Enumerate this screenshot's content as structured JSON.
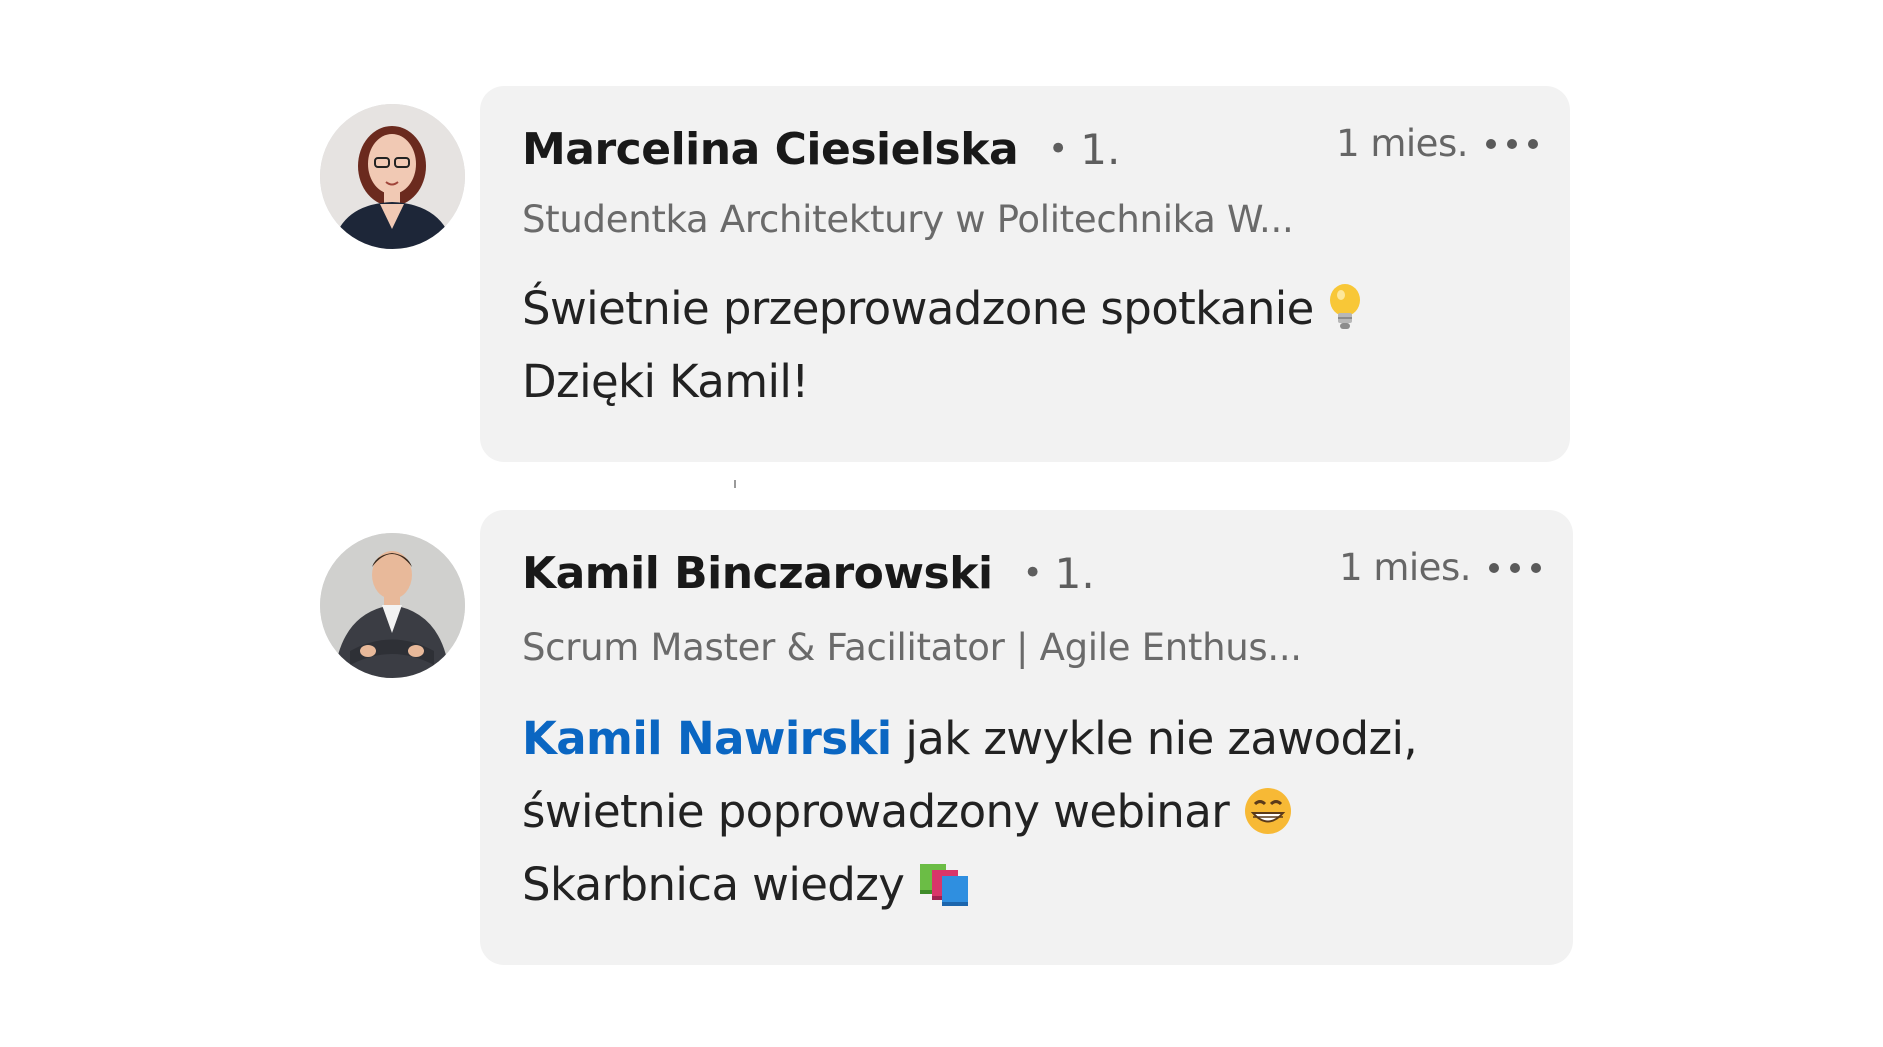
{
  "comments": [
    {
      "author": "Marcelina Ciesielska",
      "degree": "1.",
      "time": "1 mies.",
      "headline": "Studentka Architektury w Politechnika W...",
      "lines": [
        "Świetnie przeprowadzone spotkanie",
        "Dzięki Kamil!"
      ],
      "emoji": "light-bulb"
    },
    {
      "author": "Kamil Binczarowski",
      "degree": "1.",
      "time": "1 mies.",
      "headline": "Scrum Master & Facilitator | Agile Enthus...",
      "mention": "Kamil Nawirski",
      "lines": [
        " jak zwykle nie zawodzi,",
        "świetnie poprowadzony webinar",
        "Skarbnica wiedzy"
      ],
      "emojis": [
        "grinning-face",
        "books"
      ]
    }
  ],
  "colors": {
    "bubble": "#f2f2f2",
    "mention": "#0a66c2",
    "name": "#191919",
    "secondary": "#666666"
  }
}
